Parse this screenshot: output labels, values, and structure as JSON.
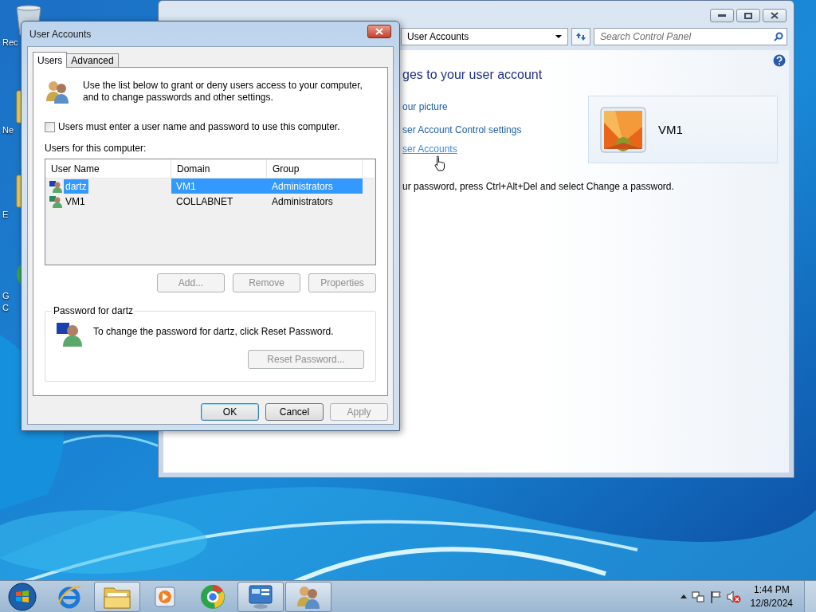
{
  "desktop": {
    "icons": [
      {
        "kind": "bin",
        "lines": [
          "Rec"
        ]
      },
      {
        "kind": "folder",
        "lines": [
          "Ne"
        ]
      },
      {
        "kind": "folder",
        "lines": [
          "E"
        ]
      },
      {
        "kind": "browser",
        "lines": [
          "G",
          "C"
        ]
      }
    ]
  },
  "control_panel": {
    "breadcrumb": "User Accounts",
    "search": {
      "placeholder": "Search Control Panel"
    },
    "heading": "ges to your user account",
    "links": [
      {
        "label": "our picture",
        "hovered": false
      },
      {
        "label": "ser Account Control settings",
        "hovered": false
      },
      {
        "label": "ser Accounts",
        "hovered": true
      }
    ],
    "account": {
      "name": "VM1"
    },
    "note": "ur password, press Ctrl+Alt+Del and select Change a password."
  },
  "dialog": {
    "title": "User Accounts",
    "tabs": [
      {
        "label": "Users",
        "selected": true
      },
      {
        "label": "Advanced",
        "selected": false
      }
    ],
    "intro": "Use the list below to grant or deny users access to your computer,\nand to change passwords and other settings.",
    "require_password": {
      "label": "Users must enter a user name and password to use this computer.",
      "checked": false
    },
    "list_label": "Users for this computer:",
    "columns": [
      "User Name",
      "Domain",
      "Group"
    ],
    "rows": [
      {
        "kind": "local",
        "cells": [
          "dartz",
          "VM1",
          "Administrators"
        ],
        "selected": true
      },
      {
        "kind": "domain",
        "cells": [
          "VM1",
          "COLLABNET",
          "Administrators"
        ],
        "selected": false
      }
    ],
    "list_buttons": [
      {
        "label": "Add...",
        "disabled": true
      },
      {
        "label": "Remove",
        "disabled": true
      },
      {
        "label": "Properties",
        "disabled": true
      }
    ],
    "password_group": {
      "title": "Password for dartz",
      "text": "To change the password for dartz, click Reset Password.",
      "button": {
        "label": "Reset Password...",
        "disabled": true
      }
    },
    "buttons": [
      {
        "label": "OK",
        "default": true,
        "disabled": false
      },
      {
        "label": "Cancel",
        "default": false,
        "disabled": false
      },
      {
        "label": "Apply",
        "default": false,
        "disabled": true
      }
    ]
  },
  "taskbar": {
    "items": [
      {
        "kind": "start",
        "active": false
      },
      {
        "kind": "globe-e",
        "active": false
      },
      {
        "kind": "folder",
        "active": true
      },
      {
        "kind": "media",
        "active": false
      },
      {
        "kind": "browser",
        "active": false
      },
      {
        "kind": "panel",
        "active": true
      },
      {
        "kind": "users",
        "active": true
      }
    ],
    "tray": {
      "time": "1:44 PM",
      "date": "12/8/2024"
    }
  }
}
